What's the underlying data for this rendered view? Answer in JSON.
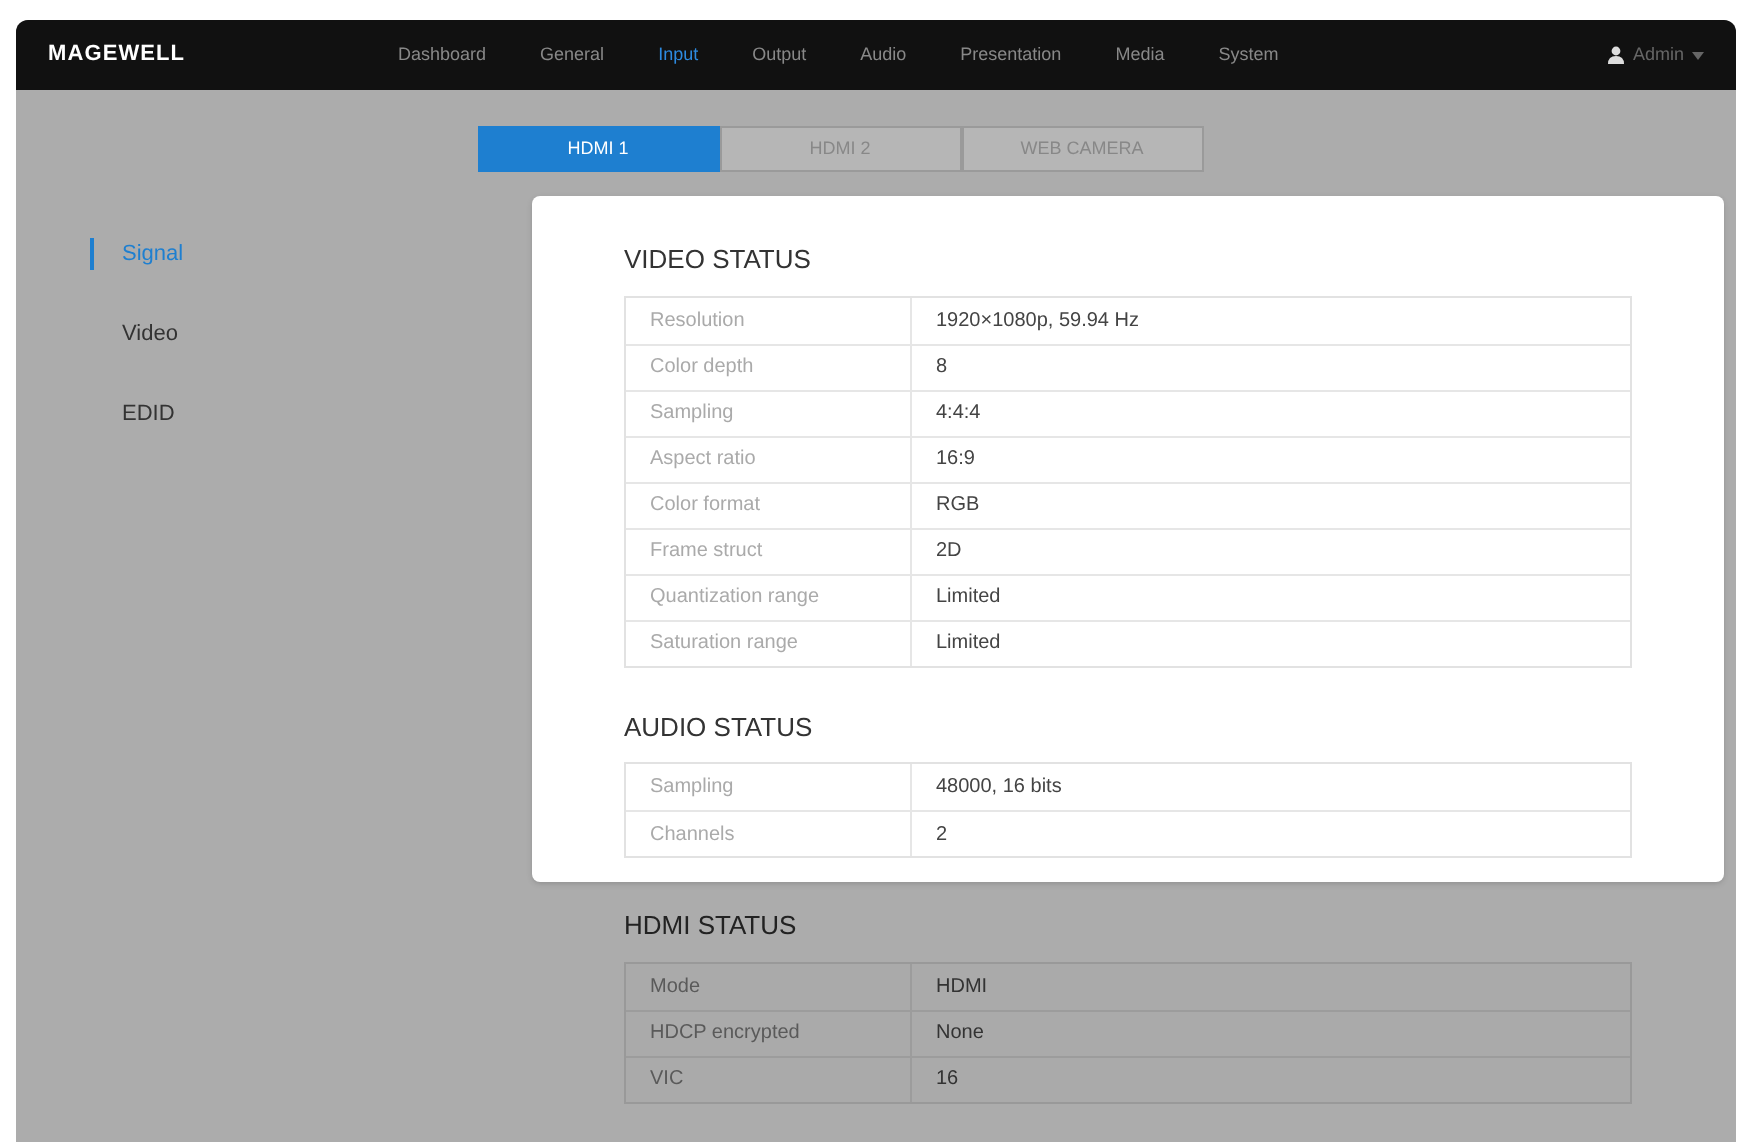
{
  "navbar": {
    "logo": "MAGEWELL",
    "items": [
      {
        "label": "Dashboard",
        "selected": false
      },
      {
        "label": "General",
        "selected": false
      },
      {
        "label": "Input",
        "selected": true
      },
      {
        "label": "Output",
        "selected": false
      },
      {
        "label": "Audio",
        "selected": false
      },
      {
        "label": "Presentation",
        "selected": false
      },
      {
        "label": "Media",
        "selected": false
      },
      {
        "label": "System",
        "selected": false
      }
    ],
    "user": "Admin"
  },
  "tabs": [
    {
      "label": "HDMI 1",
      "selected": true
    },
    {
      "label": "HDMI 2",
      "selected": false
    },
    {
      "label": "WEB CAMERA",
      "selected": false
    }
  ],
  "sidebar": {
    "items": [
      {
        "label": "Signal",
        "selected": true
      },
      {
        "label": "Video",
        "selected": false
      },
      {
        "label": "EDID",
        "selected": false
      }
    ]
  },
  "sections": [
    {
      "title": "VIDEO STATUS",
      "highlighted": true,
      "rows": [
        {
          "label": "Resolution",
          "value": "1920×1080p, 59.94 Hz"
        },
        {
          "label": "Color depth",
          "value": "8"
        },
        {
          "label": "Sampling",
          "value": "4:4:4"
        },
        {
          "label": "Aspect ratio",
          "value": "16:9"
        },
        {
          "label": "Color format",
          "value": "RGB"
        },
        {
          "label": "Frame struct",
          "value": "2D"
        },
        {
          "label": "Quantization range",
          "value": "Limited"
        },
        {
          "label": "Saturation range",
          "value": "Limited"
        }
      ]
    },
    {
      "title": "AUDIO STATUS",
      "highlighted": true,
      "rows": [
        {
          "label": "Sampling",
          "value": "48000, 16 bits"
        },
        {
          "label": "Channels",
          "value": "2"
        }
      ]
    },
    {
      "title": "HDMI STATUS",
      "highlighted": false,
      "rows": [
        {
          "label": "Mode",
          "value": "HDMI"
        },
        {
          "label": "HDCP encrypted",
          "value": "None"
        },
        {
          "label": "VIC",
          "value": "16"
        }
      ]
    }
  ]
}
